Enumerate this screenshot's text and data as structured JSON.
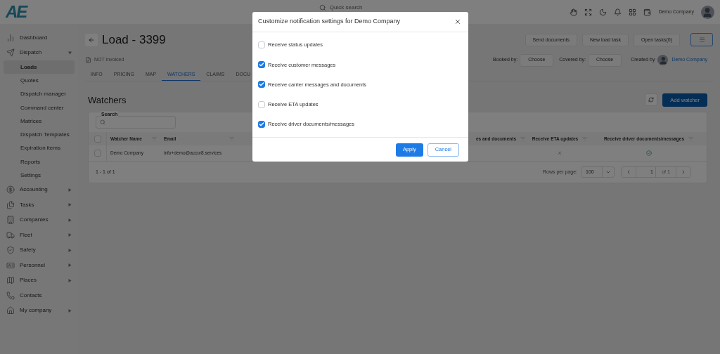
{
  "topbar": {
    "logo": "AE",
    "search_placeholder": "Quick search",
    "user": "Demo Company"
  },
  "sidebar": {
    "items": [
      {
        "label": "Dashboard",
        "kind": "link"
      },
      {
        "label": "Dispatch",
        "kind": "group",
        "expanded": true,
        "children": [
          {
            "label": "Loads",
            "selected": true
          },
          {
            "label": "Quotes",
            "selected": false
          },
          {
            "label": "Dispatch manager",
            "selected": false
          },
          {
            "label": "Command center",
            "selected": false
          },
          {
            "label": "Matrices",
            "selected": false
          },
          {
            "label": "Dispatch Templates",
            "selected": false
          },
          {
            "label": "Expiration items",
            "selected": false
          },
          {
            "label": "Reports",
            "selected": false
          },
          {
            "label": "Settings",
            "selected": false
          }
        ]
      },
      {
        "label": "Accounting",
        "kind": "group",
        "expanded": false
      },
      {
        "label": "Tasks",
        "kind": "group",
        "expanded": false
      },
      {
        "label": "Companies",
        "kind": "group",
        "expanded": false
      },
      {
        "label": "Fleet",
        "kind": "group",
        "expanded": false
      },
      {
        "label": "Safety",
        "kind": "group",
        "expanded": false
      },
      {
        "label": "Personnel",
        "kind": "group",
        "expanded": false
      },
      {
        "label": "Places",
        "kind": "group",
        "expanded": false
      },
      {
        "label": "Contacts",
        "kind": "link"
      },
      {
        "label": "My company",
        "kind": "group",
        "expanded": false
      }
    ]
  },
  "load": {
    "title": "Load - 3399",
    "invoice_status": "NOT invoiced",
    "actions": [
      "Send documents",
      "New load task",
      "Open tasks(0)"
    ],
    "booked_by": {
      "label": "Booked by:",
      "value": "Choose"
    },
    "covered_by": {
      "label": "Covered by:",
      "value": "Choose"
    },
    "created_by": {
      "label": "Created by",
      "value": "Demo Company"
    },
    "tabs": [
      {
        "label": "INFO",
        "selected": false
      },
      {
        "label": "PRICING",
        "selected": false
      },
      {
        "label": "MAP",
        "selected": false
      },
      {
        "label": "WATCHERS",
        "selected": true
      },
      {
        "label": "CLAIMS",
        "selected": false
      },
      {
        "label": "DOCU",
        "selected": false
      }
    ]
  },
  "watchers": {
    "title": "Watchers",
    "add_button": "Add watcher",
    "search_label": "Search",
    "columns": [
      "Watcher Name",
      "Email",
      "es and documents",
      "Receive ETA updates",
      "Receive driver documents/messages"
    ],
    "header_checked": false,
    "rows": [
      {
        "selected": false,
        "name": "Demo Company",
        "email": "info+demo@accur8.services",
        "eta_updates": false,
        "driver_messages": true
      }
    ],
    "range": "1 - 1 of 1",
    "rows_per_page_label": "Rows per page:",
    "rows_per_page": "100",
    "page": "1",
    "page_total": "of 1"
  },
  "dialog": {
    "title": "Customize notification settings for Demo Company",
    "options": [
      {
        "label": "Receive status updates",
        "checked": false
      },
      {
        "label": "Receive customer messages",
        "checked": true
      },
      {
        "label": "Receive carrier messages and documents",
        "checked": true
      },
      {
        "label": "Receive ETA updates",
        "checked": false
      },
      {
        "label": "Receive driver documents/messages",
        "checked": true
      }
    ],
    "buttons": [
      {
        "label": "Apply",
        "kind": "primary"
      },
      {
        "label": "Cancel",
        "kind": "outline"
      }
    ]
  }
}
